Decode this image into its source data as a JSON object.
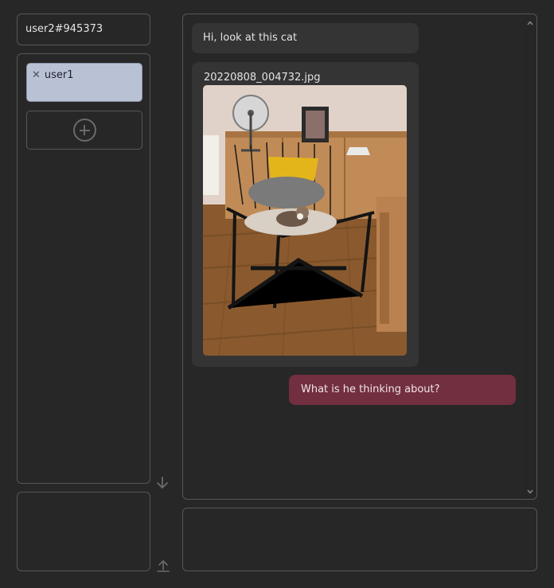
{
  "user": {
    "id": "user2#945373"
  },
  "contacts": {
    "items": [
      {
        "name": "user1",
        "remove_icon": "close-icon"
      }
    ],
    "add_icon": "plus-circle-icon"
  },
  "side_icons": {
    "download": "arrow-down-icon",
    "upload": "upload-icon"
  },
  "chat": {
    "messages": [
      {
        "sender": "other",
        "text": "Hi, look at this cat"
      },
      {
        "sender": "other",
        "type": "image",
        "filename": "20220808_004732.jpg"
      },
      {
        "sender": "self",
        "text": "What is he thinking about?"
      }
    ],
    "scrollbar_icons": {
      "up": "chevron-up-icon",
      "down": "chevron-down-icon"
    }
  },
  "colors": {
    "background": "#272727",
    "panel_border": "#575757",
    "bubble_other": "#343434",
    "bubble_self": "#722f3f",
    "contact_selected": "#b9c1d5"
  }
}
